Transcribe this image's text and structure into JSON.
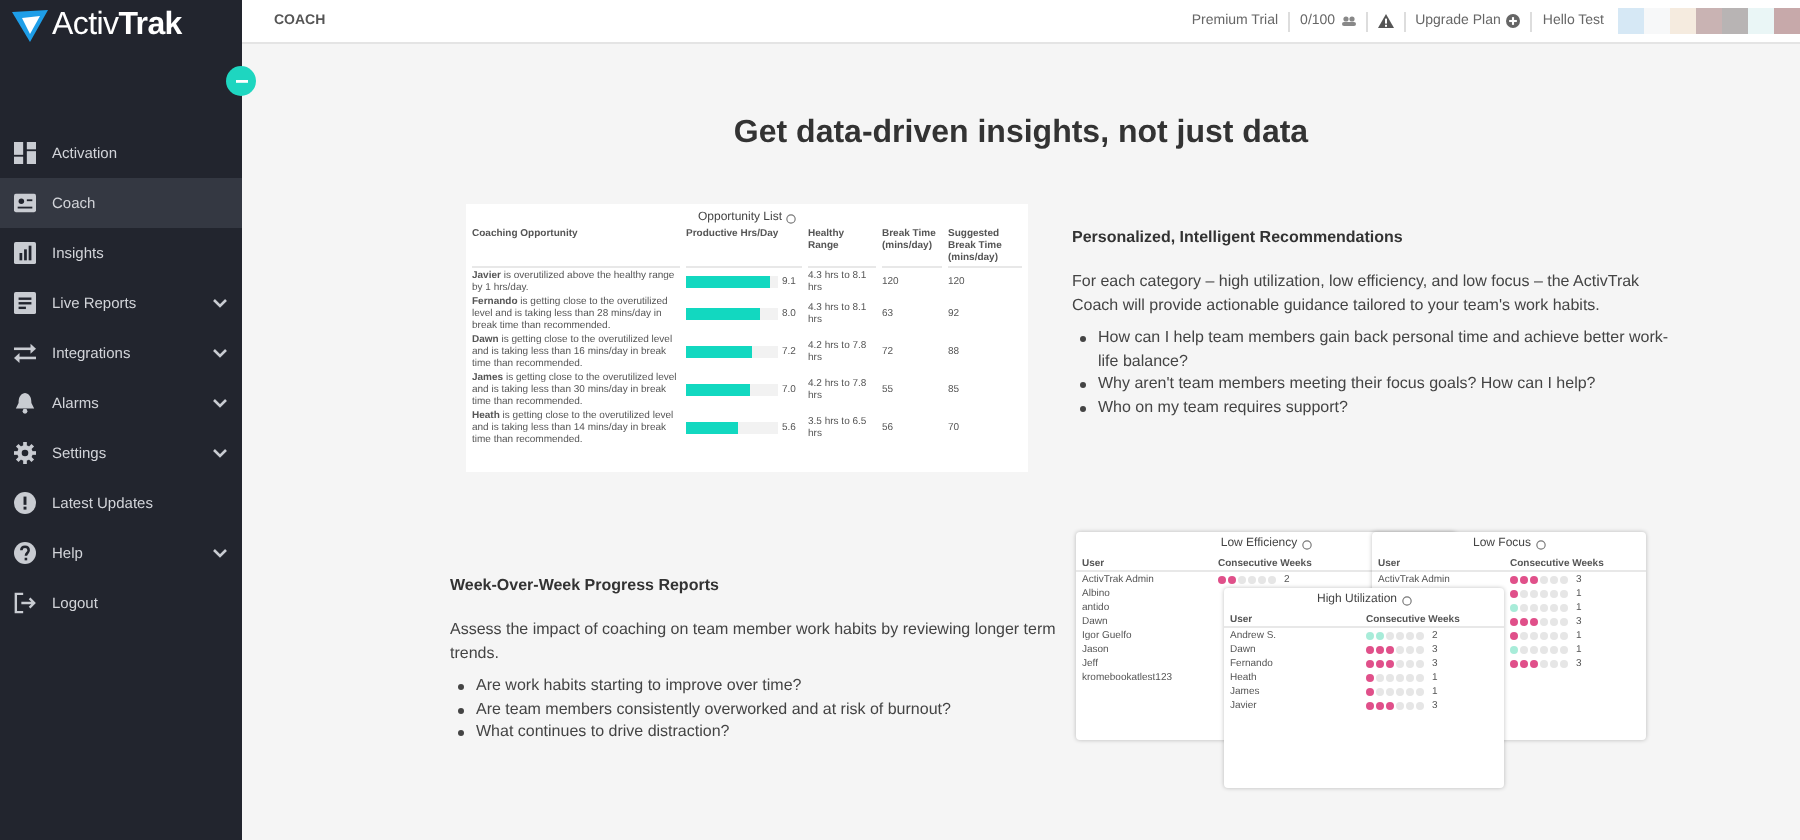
{
  "sidebar": {
    "logo": {
      "light": "Activ",
      "bold": "Trak"
    },
    "items": [
      {
        "label": "Activation",
        "kind": "grid",
        "selected": false,
        "expandable": false
      },
      {
        "label": "Coach",
        "kind": "card",
        "selected": true,
        "expandable": false
      },
      {
        "label": "Insights",
        "kind": "chart",
        "selected": false,
        "expandable": false
      },
      {
        "label": "Live Reports",
        "kind": "doc",
        "selected": false,
        "expandable": true
      },
      {
        "label": "Integrations",
        "kind": "arrows",
        "selected": false,
        "expandable": true
      },
      {
        "label": "Alarms",
        "kind": "bell",
        "selected": false,
        "expandable": true
      },
      {
        "label": "Settings",
        "kind": "gear",
        "selected": false,
        "expandable": true
      },
      {
        "label": "Latest Updates",
        "kind": "alert",
        "selected": false,
        "expandable": false
      },
      {
        "label": "Help",
        "kind": "help",
        "selected": false,
        "expandable": true
      },
      {
        "label": "Logout",
        "kind": "logout",
        "selected": false,
        "expandable": false
      }
    ]
  },
  "header": {
    "title": "COACH",
    "plan": "Premium Trial",
    "usage": "0/100",
    "upgrade": "Upgrade Plan",
    "greeting": "Hello Test"
  },
  "headline": "Get data-driven insights, not just data",
  "opportunity_list": {
    "title": "Opportunity List",
    "columns": [
      "Coaching Opportunity",
      "Productive Hrs/Day",
      "Healthy Range",
      "Break Time (mins/day)",
      "Suggested Break Time (mins/day)"
    ],
    "rows": [
      {
        "message": "**Javier** is overutilized above the healthy range by 1 hrs/day.",
        "level": 0.91,
        "hours": "9.1",
        "range": "4.3 hrs to 8.1 hrs",
        "break": "120",
        "suggested": "120"
      },
      {
        "message": "**Fernando** is getting close to the overutilized level and is taking less than 28 mins/day in break time than recommended.",
        "level": 0.8,
        "hours": "8.0",
        "range": "4.3 hrs to 8.1 hrs",
        "break": "63",
        "suggested": "92"
      },
      {
        "message": "**Dawn** is getting close to the overutilized level and is taking less than 16 mins/day in break time than recommended.",
        "level": 0.72,
        "hours": "7.2",
        "range": "4.2 hrs to 7.8 hrs",
        "break": "72",
        "suggested": "88"
      },
      {
        "message": "**James** is getting close to the overutilized level and is taking less than 30 mins/day in break time than recommended.",
        "level": 0.7,
        "hours": "7.0",
        "range": "4.2 hrs to 7.8 hrs",
        "break": "55",
        "suggested": "85"
      },
      {
        "message": "**Heath** is getting close to the overutilized level and is taking less than 14 mins/day in break time than recommended.",
        "level": 0.56,
        "hours": "5.6",
        "range": "3.5 hrs to 6.5 hrs",
        "break": "56",
        "suggested": "70"
      }
    ]
  },
  "recommendations": {
    "title": "Personalized, Intelligent Recommendations",
    "text": "For each category – high utilization, low efficiency, and low focus – the ActivTrak Coach will provide actionable guidance tailored to your team's work habits.",
    "bullets": [
      "How can I help team members gain back personal time and achieve better work-life balance?",
      "Why aren't team members meeting their focus goals? How can I help?",
      "Who on my team requires support?"
    ]
  },
  "progress": {
    "title": "Week-Over-Week Progress Reports",
    "text": "Assess the impact of coaching on team member work habits by reviewing longer term trends.",
    "bullets": [
      "Are work habits starting to improve over time?",
      "Are team members consistently overworked and at risk of burnout?",
      "What continues to drive distraction?"
    ]
  },
  "weekly_cards": [
    {
      "title": "Low Efficiency",
      "columns": [
        "User",
        "Consecutive Weeks"
      ],
      "rows": [
        {
          "user": "ActivTrak Admin",
          "stars": 2,
          "count": "2",
          "color": "#e0508a"
        },
        {
          "user": "Albino"
        },
        {
          "user": "antido"
        },
        {
          "user": "Dawn"
        },
        {
          "user": "Igor Guelfo"
        },
        {
          "user": "Jason"
        },
        {
          "user": "Jeff"
        },
        {
          "user": "kromebookatlest123"
        }
      ]
    },
    {
      "title": "Low Focus",
      "columns": [
        "User",
        "Consecutive Weeks"
      ],
      "rows": [
        {
          "user": "ActivTrak Admin",
          "stars": 3,
          "count": "3",
          "color": "#e0508a"
        },
        {
          "stars": 1,
          "count": "1",
          "color": "#e0508a"
        },
        {
          "stars": 1,
          "count": "1",
          "color": "#a8ecd9"
        },
        {
          "stars": 3,
          "count": "3",
          "color": "#e0508a"
        },
        {
          "stars": 1,
          "count": "1",
          "color": "#e0508a"
        },
        {
          "stars": 1,
          "count": "1",
          "color": "#a8ecd9"
        },
        {
          "stars": 3,
          "count": "3",
          "color": "#e0508a"
        }
      ]
    },
    {
      "title": "High Utilization",
      "columns": [
        "User",
        "Consecutive Weeks"
      ],
      "rows": [
        {
          "user": "Andrew S.",
          "stars": 2,
          "count": "2",
          "color": "#a8ecd9"
        },
        {
          "user": "Dawn",
          "stars": 3,
          "count": "3",
          "color": "#e0508a"
        },
        {
          "user": "Fernando",
          "stars": 3,
          "count": "3",
          "color": "#e0508a"
        },
        {
          "user": "Heath",
          "stars": 1,
          "count": "1",
          "color": "#e0508a"
        },
        {
          "user": "James",
          "stars": 1,
          "count": "1",
          "color": "#e0508a"
        },
        {
          "user": "Javier",
          "stars": 3,
          "count": "3",
          "color": "#e0508a"
        }
      ]
    }
  ]
}
